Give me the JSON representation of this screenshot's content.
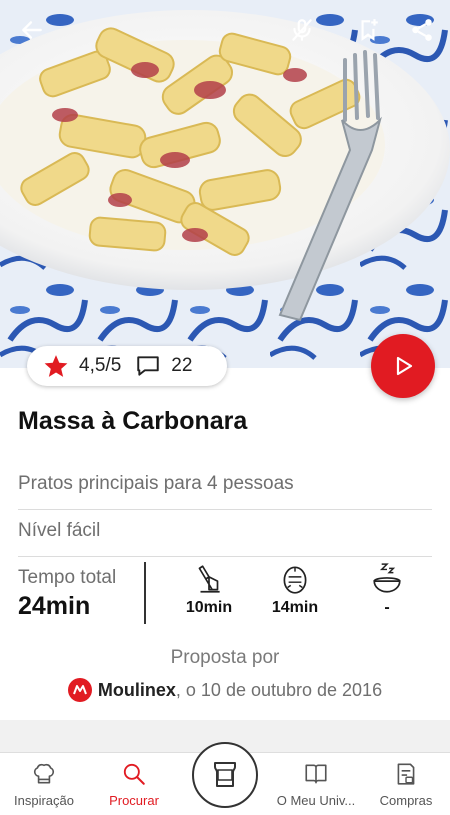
{
  "header": {
    "back_icon": "arrow-left-icon",
    "mic_icon": "mic-off-icon",
    "bookmark_icon": "bookmark-add-icon",
    "share_icon": "share-icon"
  },
  "rating": {
    "score": "4,5/5",
    "comments": "22"
  },
  "recipe": {
    "title": "Massa à Carbonara",
    "category": "Pratos principais para 4 pessoas",
    "difficulty": "Nível fácil",
    "total_label": "Tempo total",
    "total_value": "24min",
    "prep_time": "10min",
    "cook_time": "14min",
    "rest_time": "-"
  },
  "author": {
    "label": "Proposta por",
    "brand": "Moulinex",
    "date_text": ", o 10 de outubro de 2016"
  },
  "nav": {
    "items": [
      {
        "label": "Inspiração",
        "icon": "chef-hat-icon"
      },
      {
        "label": "Procurar",
        "icon": "search-icon"
      },
      {
        "label": "O Meu Univ...",
        "icon": "book-icon"
      },
      {
        "label": "Compras",
        "icon": "shopping-list-icon"
      }
    ]
  },
  "colors": {
    "accent": "#e11b22"
  }
}
